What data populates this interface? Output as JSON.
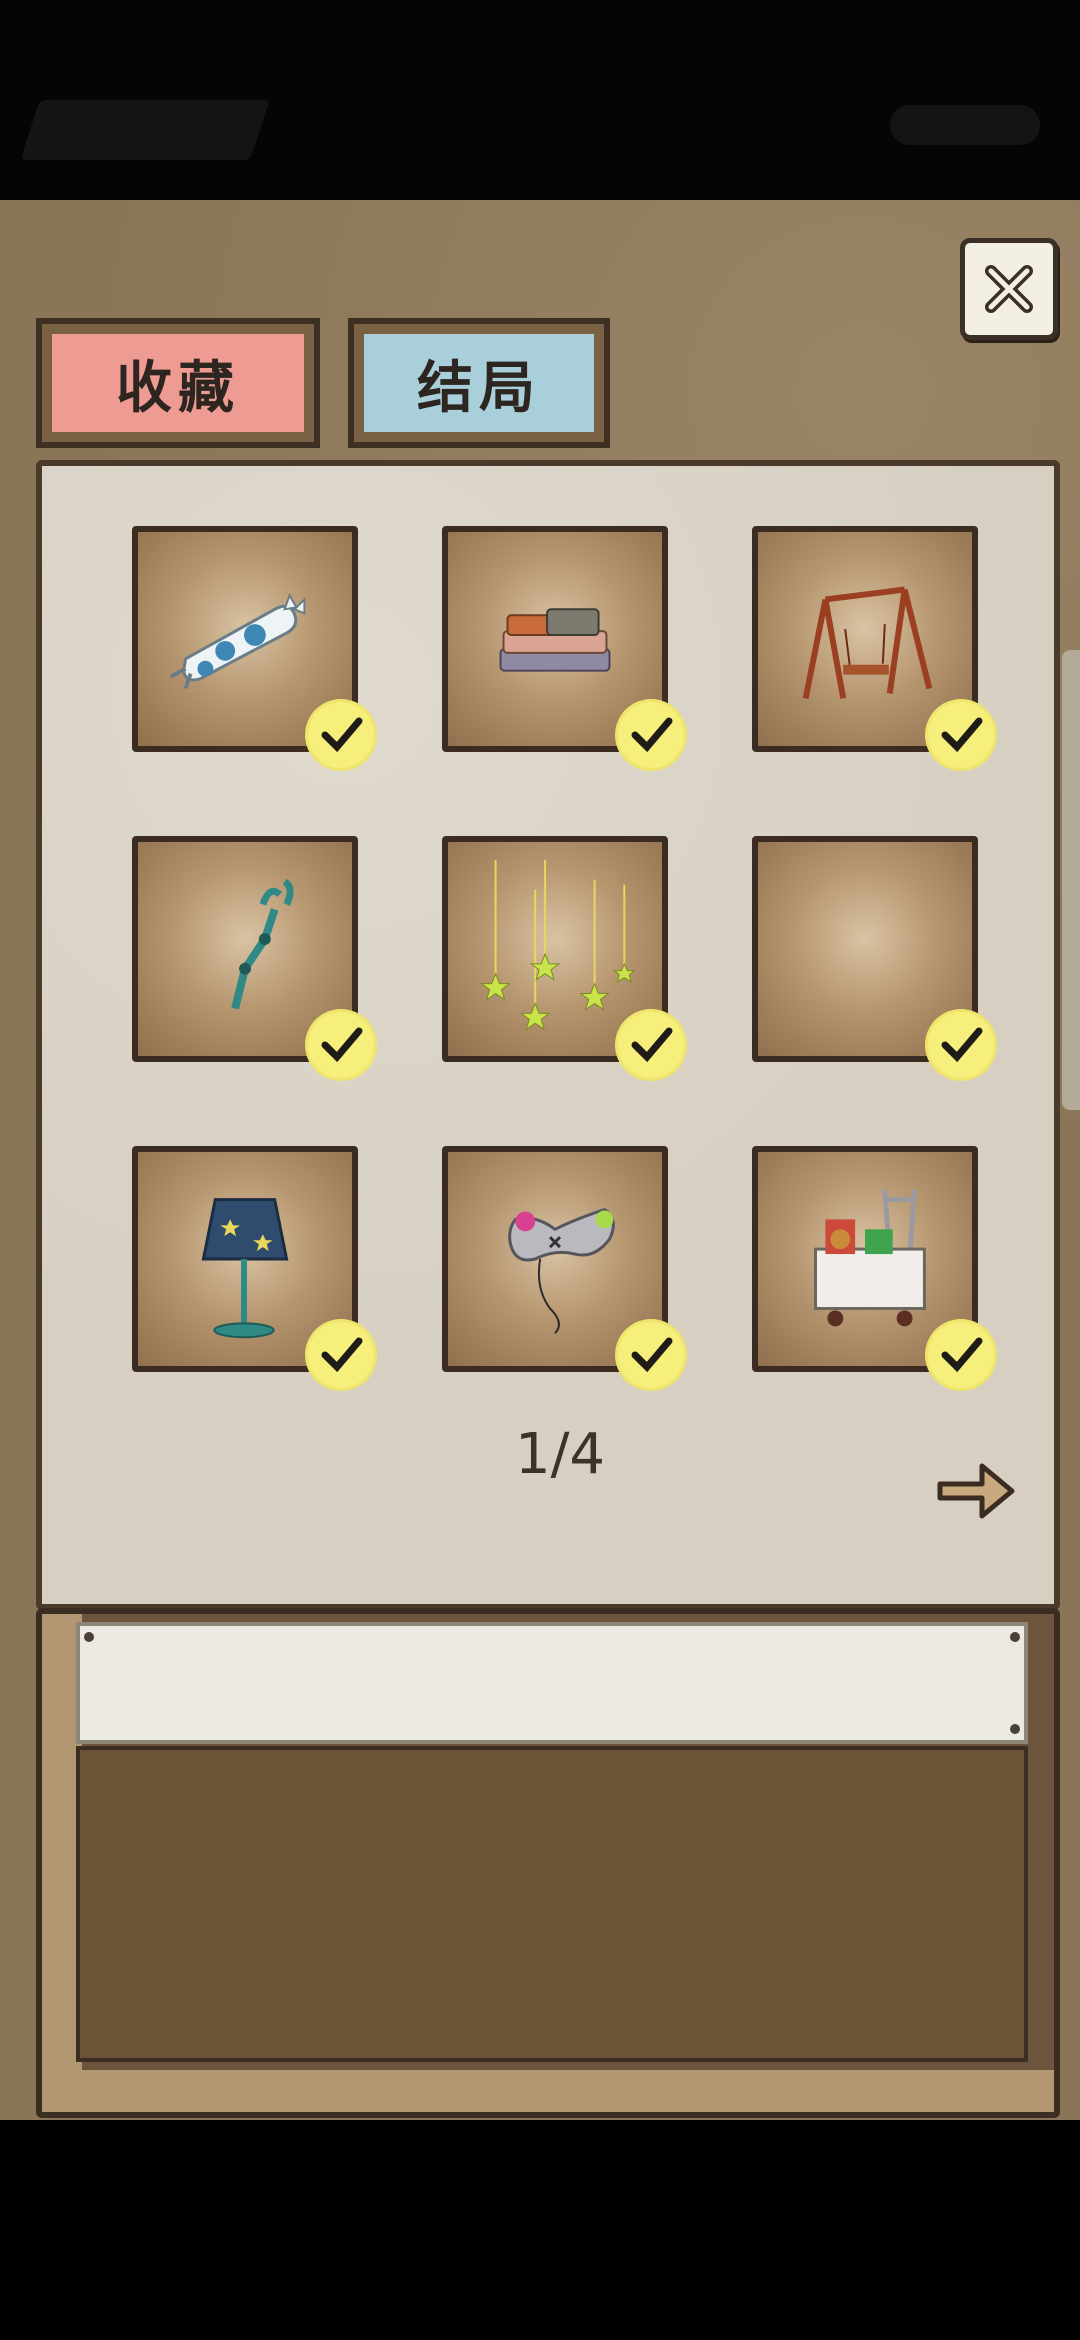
{
  "tabs": {
    "collect_label": "收藏",
    "ending_label": "结局"
  },
  "collection": {
    "items": [
      {
        "name": "cat-pillow",
        "collected": true
      },
      {
        "name": "folded-clothes",
        "collected": true
      },
      {
        "name": "wooden-swing",
        "collected": true
      },
      {
        "name": "grabber-claw",
        "collected": true
      },
      {
        "name": "hanging-stars",
        "collected": true
      },
      {
        "name": "empty-slot",
        "collected": true
      },
      {
        "name": "star-lamp",
        "collected": true
      },
      {
        "name": "game-controller",
        "collected": true
      },
      {
        "name": "shopping-cart",
        "collected": true
      }
    ]
  },
  "pagination": {
    "label": "1/4",
    "current": 1,
    "total": 4
  },
  "description": {
    "title": "",
    "body": ""
  },
  "colors": {
    "collect_tab": "#ee9c93",
    "ending_tab": "#a9cfda",
    "check": "#f6ef7c",
    "panel": "#d6cfc2",
    "board": "#8b7558"
  },
  "icons": {
    "close": "close-icon",
    "next": "arrow-right-icon",
    "check": "check-icon"
  }
}
